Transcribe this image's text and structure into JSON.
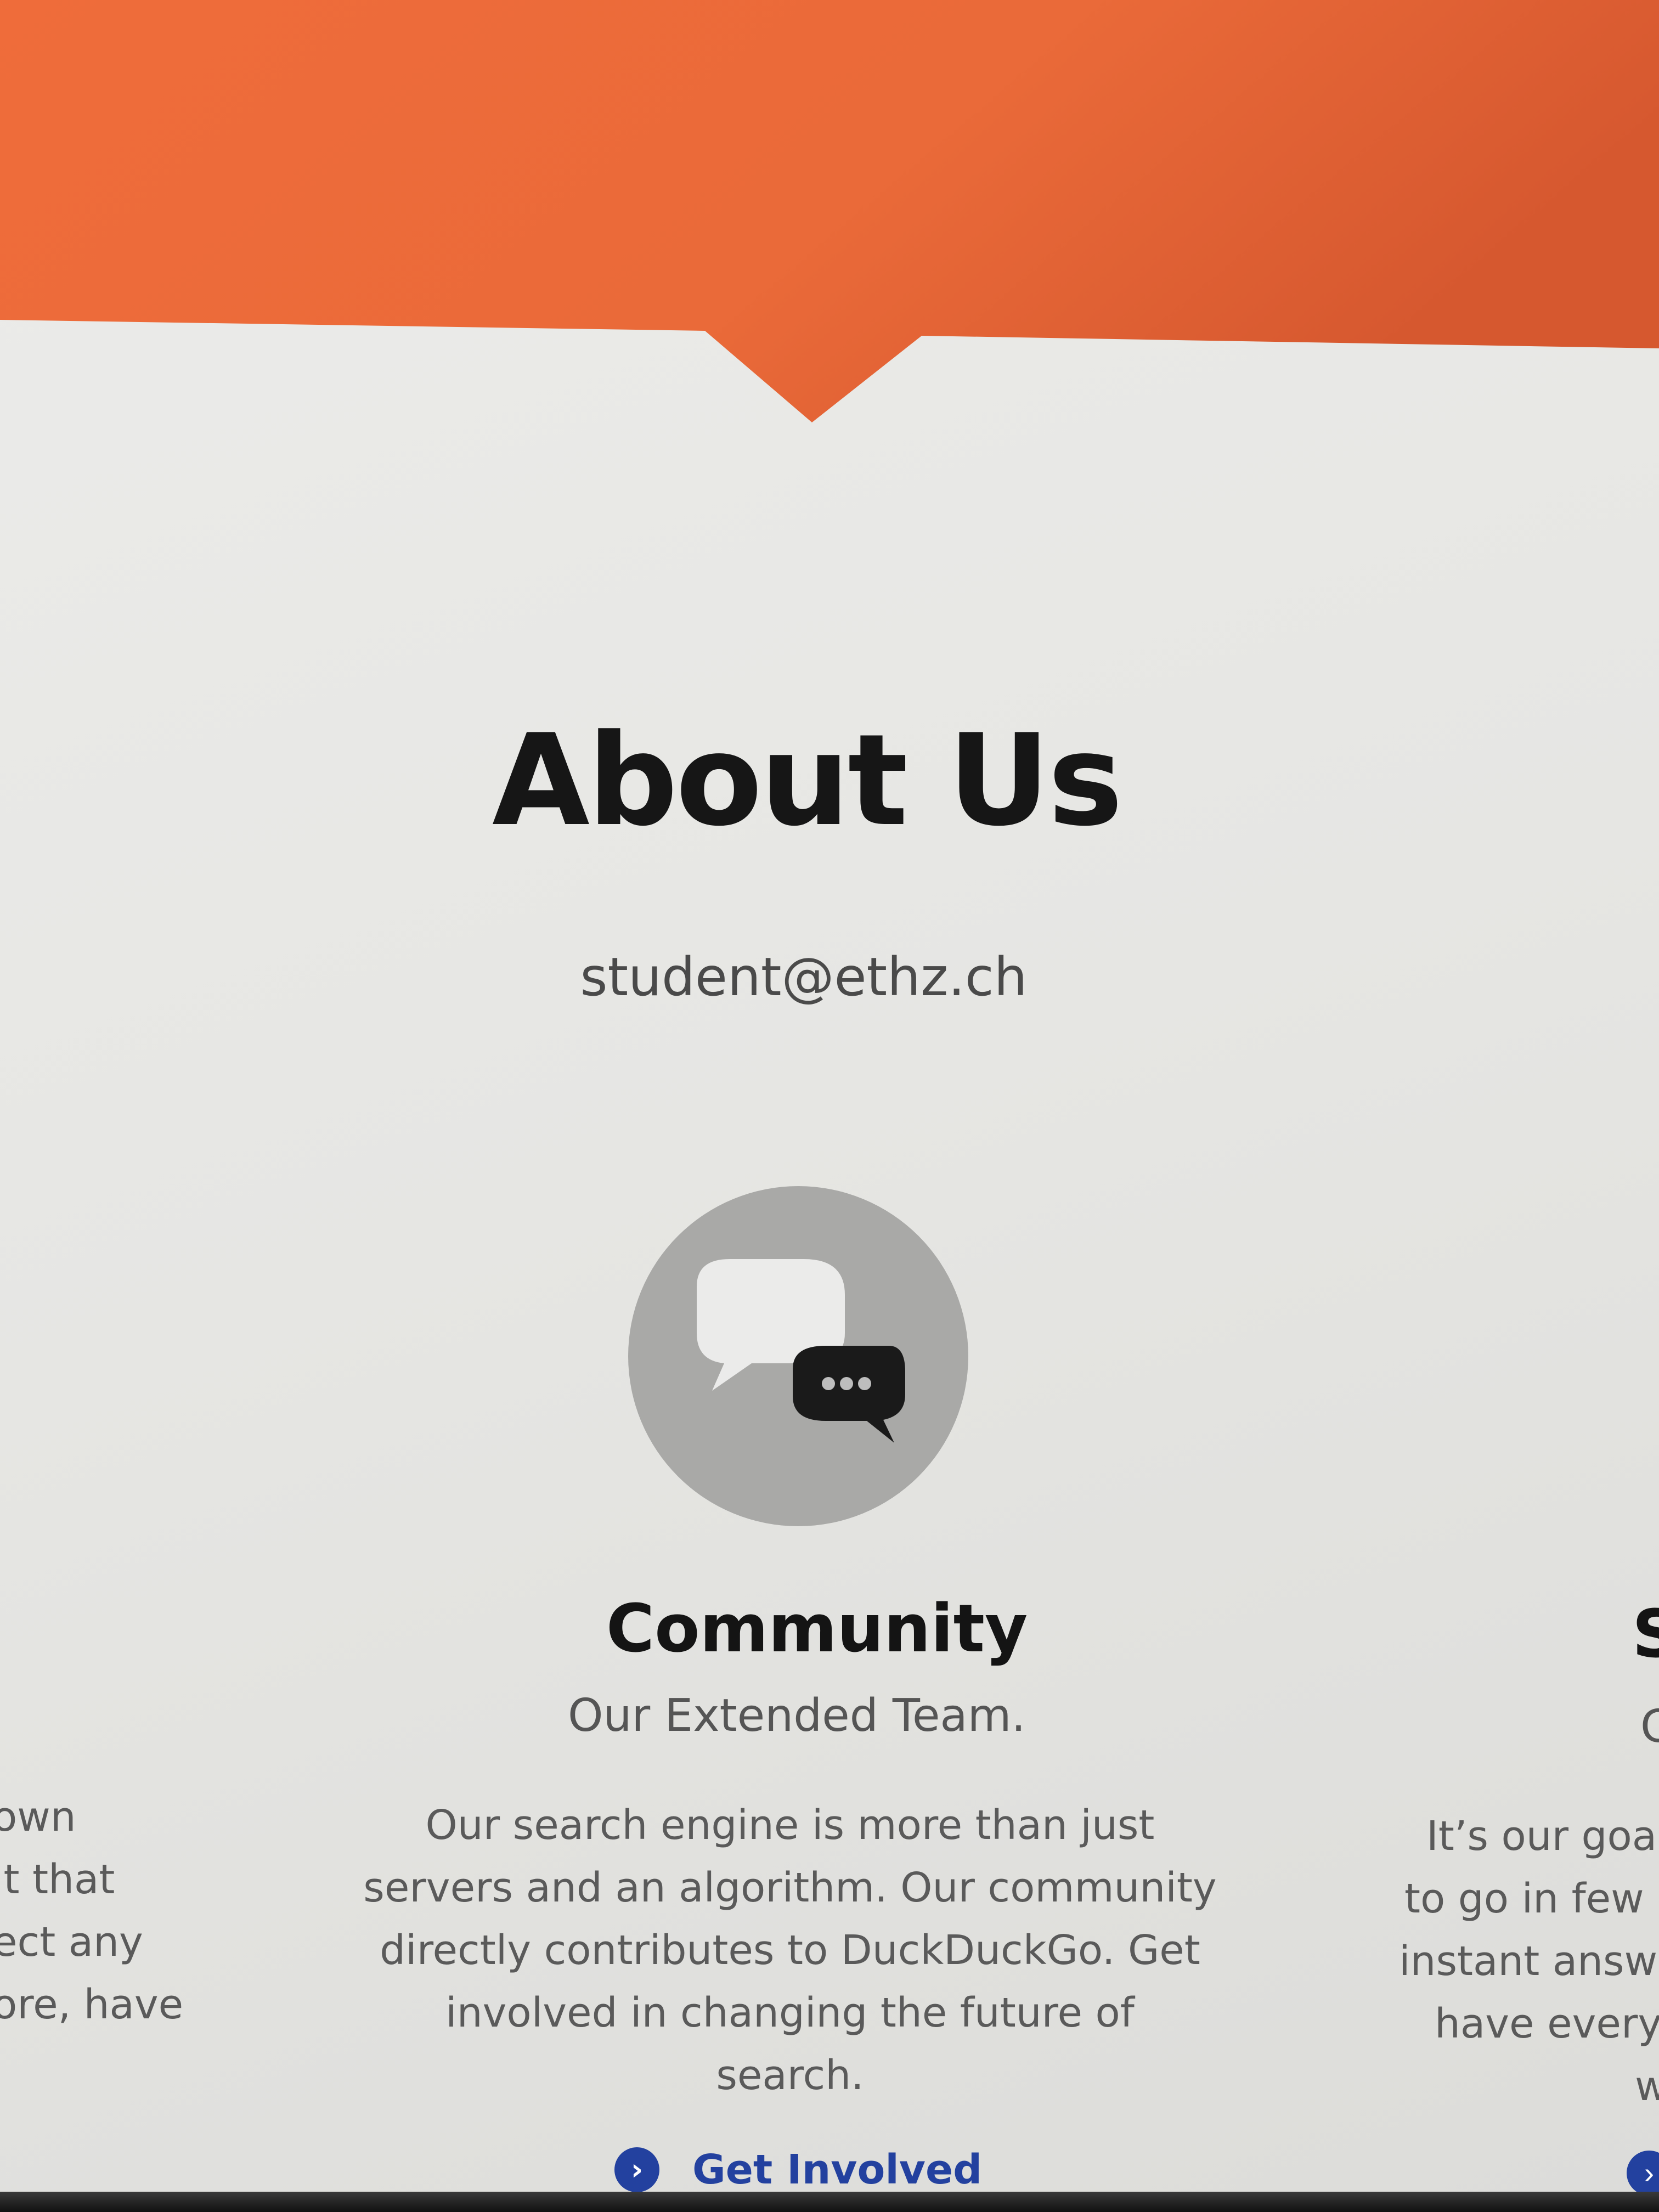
{
  "colors": {
    "hero_orange": "#e9683a",
    "link_blue": "#23419f",
    "title_dark": "#161616",
    "body_grey": "#5a5a5a"
  },
  "about": {
    "title": "About Us",
    "email": "student@ethz.ch"
  },
  "community": {
    "icon": "chat-bubbles-icon",
    "title": "Community",
    "subtitle": "Our Extended Team.",
    "body_lines": [
      "Our search engine is more than just",
      "servers and an algorithm. Our community",
      "directly contributes to DuckDuckGo. Get",
      "involved in changing the future of",
      "search."
    ],
    "link_icon": "chevron-right-circle-icon",
    "link_label": "Get Involved"
  },
  "left_column_fragment": {
    "body_lines": [
      "own",
      "it that",
      "ect any",
      "ore, have"
    ]
  },
  "right_column_fragment": {
    "title": "S",
    "subtitle": "C",
    "body_lines": [
      "It’s our goa",
      "to go in few",
      "instant answ",
      "have every",
      "w"
    ],
    "link_icon": "chevron-right-circle-icon"
  }
}
